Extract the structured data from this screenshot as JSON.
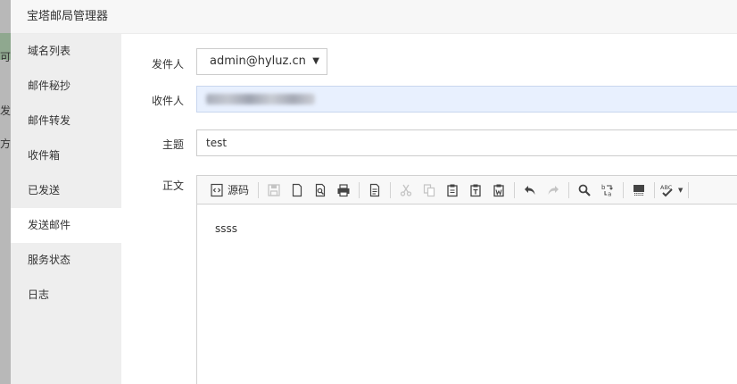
{
  "background_page": {
    "fragments": [
      "可",
      "发",
      "方"
    ]
  },
  "dialog": {
    "title": "宝塔邮局管理器"
  },
  "sidebar": {
    "items": [
      {
        "label": "域名列表"
      },
      {
        "label": "邮件秘抄"
      },
      {
        "label": "邮件转发"
      },
      {
        "label": "收件箱"
      },
      {
        "label": "已发送"
      },
      {
        "label": "发送邮件"
      },
      {
        "label": "服务状态"
      },
      {
        "label": "日志"
      }
    ],
    "active_index": 5
  },
  "form": {
    "sender_label": "发件人",
    "sender_value": "admin@hyluz.cn",
    "recipient_label": "收件人",
    "subject_label": "主题",
    "subject_value": "test",
    "body_label": "正文",
    "body_text": "ssss"
  },
  "editor": {
    "source_label": "源码",
    "toolbar_icons": [
      "source-icon",
      "save-icon",
      "new-page-icon",
      "preview-icon",
      "print-icon",
      "templates-icon",
      "cut-icon",
      "copy-icon",
      "paste-icon",
      "paste-text-icon",
      "paste-word-icon",
      "undo-icon",
      "redo-icon",
      "find-icon",
      "replace-icon",
      "select-all-icon",
      "spellcheck-icon"
    ],
    "spellcheck_label": "ABC"
  },
  "colors": {
    "sidebar_bg": "#eeeeee",
    "recipient_autofill_bg": "#e8f0fe"
  }
}
